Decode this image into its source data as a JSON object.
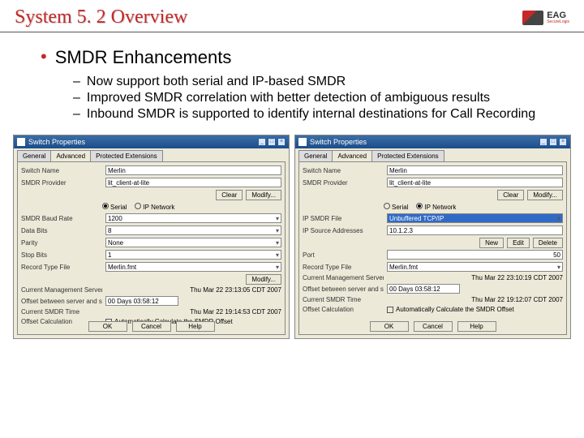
{
  "header": {
    "title": "System 5. 2 Overview",
    "logo_main": "EAG",
    "logo_sub": "SecureLogix"
  },
  "content": {
    "l1": "SMDR Enhancements",
    "l2": [
      "Now support both serial and IP-based SMDR",
      "Improved SMDR correlation with better detection of ambiguous results",
      "Inbound SMDR is supported to identify internal destinations for Call Recording"
    ]
  },
  "dialog": {
    "title": "Switch Properties",
    "tabs": [
      "General",
      "Advanced",
      "Protected Extensions"
    ],
    "labels": {
      "switch_name": "Switch Name",
      "smdr_provider": "SMDR Provider",
      "clear": "Clear",
      "modify": "Modify...",
      "serial": "Serial",
      "ip_network": "IP Network",
      "baud": "SMDR Baud Rate",
      "databits": "Data Bits",
      "parity": "Parity",
      "stopbits": "Stop Bits",
      "rec_type": "Record Type File",
      "ip_file": "IP SMDR File",
      "ip_source": "IP Source Addresses",
      "port": "Port",
      "new": "New",
      "edit": "Edit",
      "delete": "Delete",
      "cur_time": "Current Management Server Time",
      "offset_srv": "Offset between server and switch",
      "time_sm": "Current SMDR Time",
      "offset_calc": "Offset Calculation",
      "auto_calc": "Automatically Calculate the SMDR Offset",
      "ok": "OK",
      "cancel": "Cancel",
      "help": "Help"
    },
    "values": {
      "switch_name": "Merlin",
      "provider": "lit_client-at-lite",
      "baud": "1200",
      "databits": "8",
      "parity": "None",
      "stopbits": "1",
      "rec_type": "Merlin.fmt",
      "ip_file": "Unbuffered TCP/IP",
      "ip_source": "10.1.2.3",
      "port": "50",
      "cur_time_left": "Thu Mar 22 23:13:05 CDT 2007",
      "cur_time_right": "Thu Mar 22 23:10:19 CDT 2007",
      "offset_val": "00 Days 03:58:12",
      "smdr_time_left": "Thu Mar 22 19:14:53 CDT 2007",
      "smdr_time_right": "Thu Mar 22 19:12:07 CDT 2007"
    }
  }
}
